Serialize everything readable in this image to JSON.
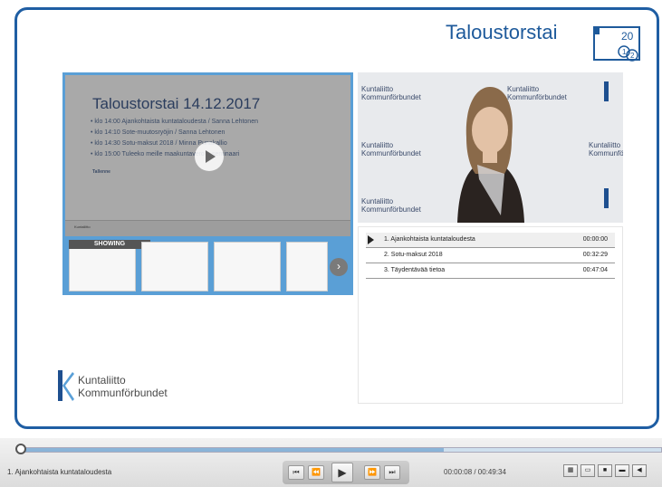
{
  "header": {
    "brand_title": "Taloustorstai",
    "calendar_number": "20",
    "calendar_days": [
      "1",
      "2"
    ]
  },
  "slide": {
    "title": "Taloustorstai 14.12.2017",
    "agenda": [
      "klo 14:00 Ajankohtaista kuntataloudesta / Sanna Lehtonen",
      "klo 14:10 Sote-muutosryöjin / Sanna Lehtonen",
      "klo 14:30 Sotu-maksut 2018 / Minna Punakallio",
      "klo 15:00 Tuleeko meille maakuntavero? -seminaari"
    ],
    "note_heading": "Tallenne",
    "thumbs_label": "SHOWING"
  },
  "video": {
    "watermark_fi": "Kuntaliitto",
    "watermark_sv": "Kommunförbundet"
  },
  "playlist": [
    {
      "title": "1. Ajankohtaista kuntataloudesta",
      "time": "00:00:00",
      "active": true
    },
    {
      "title": "2. Sotu-maksut 2018",
      "time": "00:32:29",
      "active": false
    },
    {
      "title": "3. Täydentävää tietoa",
      "time": "00:47:04",
      "active": false
    }
  ],
  "logo": {
    "line1": "Kuntaliitto",
    "line2": "Kommunförbundet"
  },
  "controls": {
    "current_title": "1. Ajankohtaista kuntataloudesta",
    "time": "00:00:08 / 00:49:34",
    "progress": 0.003,
    "buffered": 0.66
  },
  "colors": {
    "accent": "#1f5ea3",
    "slide_bg": "#a9a9a9",
    "thumb_border": "#5a9fd6"
  }
}
